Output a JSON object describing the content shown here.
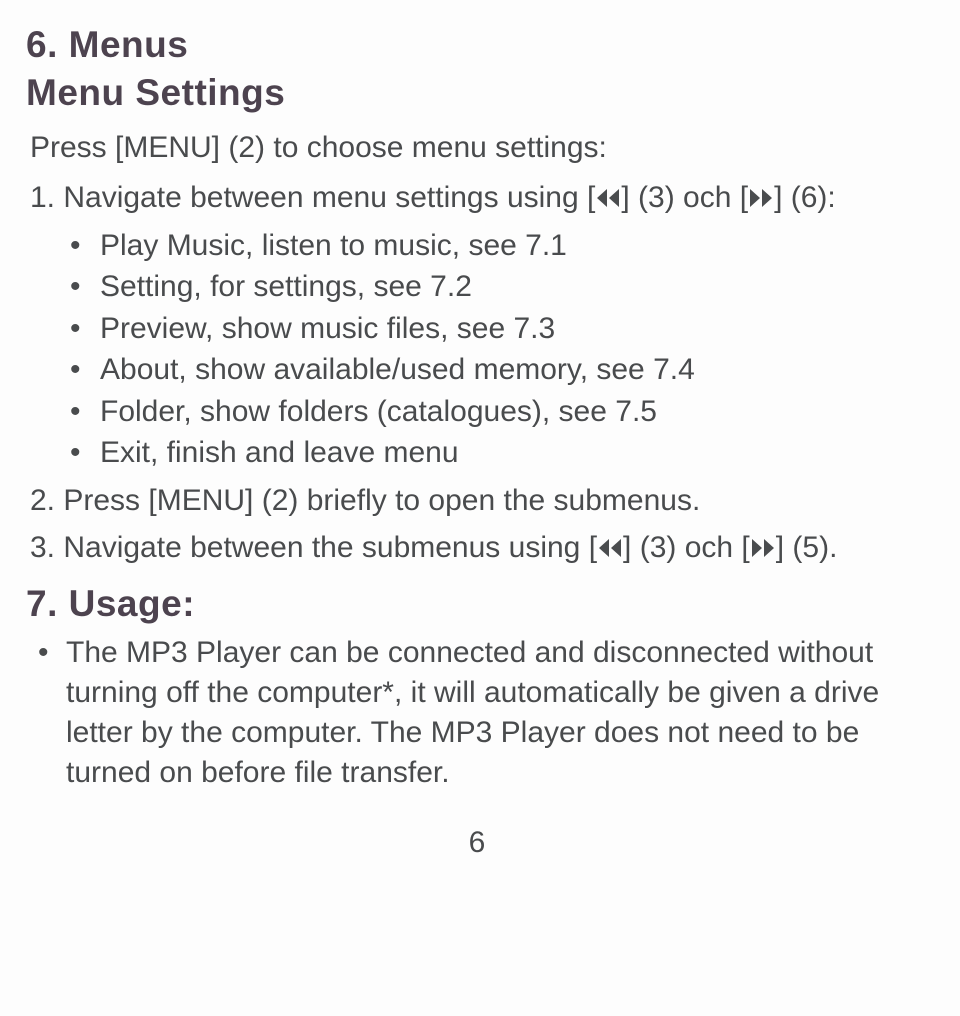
{
  "section6": {
    "heading": "6. Menus",
    "subheading": "Menu Settings",
    "intro": "Press [MENU] (2) to choose menu settings:",
    "step1": {
      "pre": "1. Navigate between menu settings using [",
      "mid": "] (3) och [",
      "post": "] (6):"
    },
    "bullets": [
      "Play Music, listen to music, see 7.1",
      "Setting, for settings, see 7.2",
      "Preview, show music ﬁles, see 7.3",
      "About, show available/used memory, see 7.4",
      "Folder, show folders (catalogues), see 7.5",
      "Exit, ﬁnish and leave menu"
    ],
    "step2": "2. Press [MENU] (2) brieﬂy to open the submenus.",
    "step3": {
      "pre": "3. Navigate between the submenus using [",
      "mid": "] (3) och [",
      "post": "] (5)."
    }
  },
  "section7": {
    "heading": "7. Usage:",
    "bullets": [
      "The MP3 Player can be connected and disconnected without turning off the computer*, it will automatically be given a drive letter by the computer. The MP3 Player does not need to be turned on before ﬁle transfer."
    ]
  },
  "page_number": "6"
}
